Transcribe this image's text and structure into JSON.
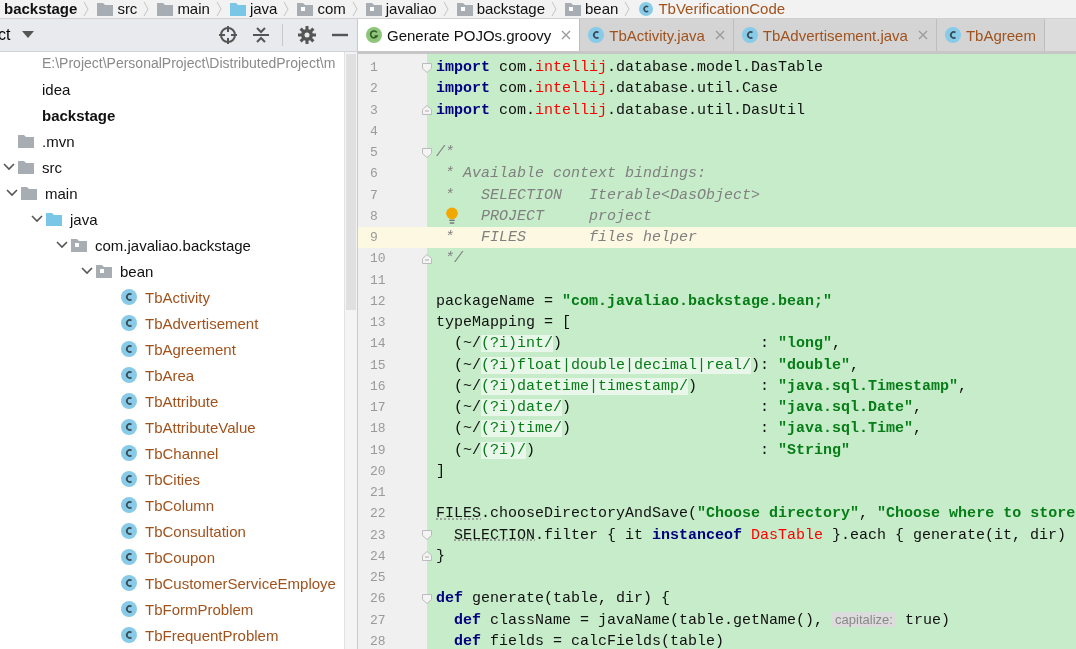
{
  "breadcrumbs": [
    {
      "label": "backstage",
      "kind": "module"
    },
    {
      "label": "src",
      "kind": "folder"
    },
    {
      "label": "main",
      "kind": "folder"
    },
    {
      "label": "java",
      "kind": "source-folder"
    },
    {
      "label": "com",
      "kind": "package"
    },
    {
      "label": "javaliao",
      "kind": "package"
    },
    {
      "label": "backstage",
      "kind": "package"
    },
    {
      "label": "bean",
      "kind": "package"
    },
    {
      "label": "TbVerificationCode",
      "kind": "class"
    }
  ],
  "project_panel": {
    "title": "ct",
    "tree": [
      {
        "label": "E:\\Project\\PersonalProject\\DistributedProject\\m",
        "kind": "path"
      },
      {
        "label": "idea",
        "kind": "item"
      },
      {
        "label": "backstage",
        "kind": "module"
      },
      {
        "label": ".mvn",
        "kind": "folder"
      },
      {
        "label": "src",
        "kind": "folder",
        "expanded": true,
        "children": [
          {
            "label": "main",
            "kind": "folder",
            "expanded": true,
            "children": [
              {
                "label": "java",
                "kind": "source-folder",
                "expanded": true,
                "children": [
                  {
                    "label": "com.javaliao.backstage",
                    "kind": "package",
                    "expanded": true,
                    "children": [
                      {
                        "label": "bean",
                        "kind": "package",
                        "expanded": true,
                        "children": [
                          {
                            "label": "TbActivity",
                            "kind": "class"
                          },
                          {
                            "label": "TbAdvertisement",
                            "kind": "class"
                          },
                          {
                            "label": "TbAgreement",
                            "kind": "class"
                          },
                          {
                            "label": "TbArea",
                            "kind": "class"
                          },
                          {
                            "label": "TbAttribute",
                            "kind": "class"
                          },
                          {
                            "label": "TbAttributeValue",
                            "kind": "class"
                          },
                          {
                            "label": "TbChannel",
                            "kind": "class"
                          },
                          {
                            "label": "TbCities",
                            "kind": "class"
                          },
                          {
                            "label": "TbColumn",
                            "kind": "class"
                          },
                          {
                            "label": "TbConsultation",
                            "kind": "class"
                          },
                          {
                            "label": "TbCoupon",
                            "kind": "class"
                          },
                          {
                            "label": "TbCustomerServiceEmploye",
                            "kind": "class"
                          },
                          {
                            "label": "TbFormProblem",
                            "kind": "class"
                          },
                          {
                            "label": "TbFrequentProblem",
                            "kind": "class"
                          }
                        ]
                      }
                    ]
                  }
                ]
              }
            ]
          }
        ]
      }
    ]
  },
  "tabs": [
    {
      "label": "Generate POJOs.groovy",
      "kind": "groovy",
      "selected": true,
      "closable": true
    },
    {
      "label": "TbActivity.java",
      "kind": "class",
      "selected": false,
      "closable": true
    },
    {
      "label": "TbAdvertisement.java",
      "kind": "class",
      "selected": false,
      "closable": true
    },
    {
      "label": "TbAgreem",
      "kind": "class",
      "selected": false,
      "closable": false
    }
  ],
  "editor": {
    "lines": [
      {
        "number": "1",
        "current": false,
        "fold_start": true,
        "segments": [
          {
            "kind": "kw",
            "text": "import"
          },
          {
            "kind": "plain",
            "text": " com."
          },
          {
            "kind": "red",
            "text": "intellij"
          },
          {
            "kind": "plain",
            "text": ".database.model.DasTable"
          }
        ]
      },
      {
        "number": "2",
        "current": false,
        "segments": [
          {
            "kind": "kw",
            "text": "import"
          },
          {
            "kind": "plain",
            "text": " com."
          },
          {
            "kind": "red",
            "text": "intellij"
          },
          {
            "kind": "plain",
            "text": ".database.util.Case"
          }
        ]
      },
      {
        "number": "3",
        "current": false,
        "fold_end": true,
        "segments": [
          {
            "kind": "kw",
            "text": "import"
          },
          {
            "kind": "plain",
            "text": " com."
          },
          {
            "kind": "red",
            "text": "intellij"
          },
          {
            "kind": "plain",
            "text": ".database.util.DasUtil"
          }
        ]
      },
      {
        "number": "4",
        "current": false
      },
      {
        "number": "5",
        "current": false,
        "fold_start": true,
        "segments": [
          {
            "kind": "comment",
            "text": "/*"
          }
        ]
      },
      {
        "number": "6",
        "current": false,
        "segments": [
          {
            "kind": "comment",
            "text": " * Available context bindings:"
          }
        ]
      },
      {
        "number": "7",
        "current": false,
        "segments": [
          {
            "kind": "comment",
            "text": " *   SELECTION   Iterable<DasObject>"
          }
        ]
      },
      {
        "number": "8",
        "current": false,
        "bulb": true,
        "segments": [
          {
            "kind": "comment",
            "text": "PROJECT     project"
          }
        ]
      },
      {
        "number": "9",
        "current": true,
        "segments": [
          {
            "kind": "comment",
            "text": " *   FILES       files helper"
          }
        ]
      },
      {
        "number": "10",
        "current": false,
        "fold_end": true,
        "segments": [
          {
            "kind": "comment",
            "text": " */"
          }
        ]
      },
      {
        "number": "11",
        "current": false
      },
      {
        "number": "12",
        "current": false,
        "segments": [
          {
            "kind": "plain",
            "text": "packageName = "
          },
          {
            "kind": "str",
            "text": "\"com.javaliao.backstage.bean;\""
          }
        ]
      },
      {
        "number": "13",
        "current": false,
        "segments": [
          {
            "kind": "plain",
            "text": "typeMapping = ["
          }
        ]
      },
      {
        "number": "14",
        "current": false,
        "segments": [
          {
            "kind": "plain",
            "text": "  (~/"
          },
          {
            "kind": "regex",
            "text": "(?i)int/"
          },
          {
            "kind": "plain",
            "text": ")                      : "
          },
          {
            "kind": "str",
            "text": "\"long\""
          },
          {
            "kind": "plain",
            "text": ","
          }
        ]
      },
      {
        "number": "15",
        "current": false,
        "segments": [
          {
            "kind": "plain",
            "text": "  (~/"
          },
          {
            "kind": "regex",
            "text": "(?i)float|double|decimal|real/"
          },
          {
            "kind": "plain",
            "text": "): "
          },
          {
            "kind": "str",
            "text": "\"double\""
          },
          {
            "kind": "plain",
            "text": ","
          }
        ]
      },
      {
        "number": "16",
        "current": false,
        "segments": [
          {
            "kind": "plain",
            "text": "  (~/"
          },
          {
            "kind": "regex",
            "text": "(?i)datetime|timestamp/"
          },
          {
            "kind": "plain",
            "text": ")       : "
          },
          {
            "kind": "str",
            "text": "\"java.sql.Timestamp\""
          },
          {
            "kind": "plain",
            "text": ","
          }
        ]
      },
      {
        "number": "17",
        "current": false,
        "segments": [
          {
            "kind": "plain",
            "text": "  (~/"
          },
          {
            "kind": "regex",
            "text": "(?i)date/"
          },
          {
            "kind": "plain",
            "text": ")                     : "
          },
          {
            "kind": "str",
            "text": "\"java.sql.Date\""
          },
          {
            "kind": "plain",
            "text": ","
          }
        ]
      },
      {
        "number": "18",
        "current": false,
        "segments": [
          {
            "kind": "plain",
            "text": "  (~/"
          },
          {
            "kind": "regex",
            "text": "(?i)time/"
          },
          {
            "kind": "plain",
            "text": ")                     : "
          },
          {
            "kind": "str",
            "text": "\"java.sql.Time\""
          },
          {
            "kind": "plain",
            "text": ","
          }
        ]
      },
      {
        "number": "19",
        "current": false,
        "segments": [
          {
            "kind": "plain",
            "text": "  (~/"
          },
          {
            "kind": "regex",
            "text": "(?i)/"
          },
          {
            "kind": "plain",
            "text": ")                         : "
          },
          {
            "kind": "str",
            "text": "\"String\""
          }
        ]
      },
      {
        "number": "20",
        "current": false,
        "segments": [
          {
            "kind": "plain",
            "text": "]"
          }
        ]
      },
      {
        "number": "21",
        "current": false
      },
      {
        "number": "22",
        "current": false,
        "segments": [
          {
            "kind": "dotted",
            "text": "FILES"
          },
          {
            "kind": "plain",
            "text": ".chooseDirectoryAndSave("
          },
          {
            "kind": "str",
            "text": "\"Choose directory\""
          },
          {
            "kind": "plain",
            "text": ", "
          },
          {
            "kind": "str",
            "text": "\"Choose where to store"
          }
        ]
      },
      {
        "number": "23",
        "current": false,
        "fold_start": true,
        "indented": true,
        "segments": [
          {
            "kind": "dotted",
            "text": "SELECTION"
          },
          {
            "kind": "plain",
            "text": ".filter { it "
          },
          {
            "kind": "kw",
            "text": "instanceof"
          },
          {
            "kind": "red",
            "text": " DasTable"
          },
          {
            "kind": "plain",
            "text": " }.each { generate(it, dir)"
          }
        ]
      },
      {
        "number": "24",
        "current": false,
        "fold_end": true,
        "segments": [
          {
            "kind": "plain",
            "text": "}"
          }
        ]
      },
      {
        "number": "25",
        "current": false
      },
      {
        "number": "26",
        "current": false,
        "fold_start": true,
        "segments": [
          {
            "kind": "kw",
            "text": "def"
          },
          {
            "kind": "plain",
            "text": " generate(table, dir) {"
          }
        ]
      },
      {
        "number": "27",
        "current": false,
        "indented": true,
        "segments": [
          {
            "kind": "kw",
            "text": "def"
          },
          {
            "kind": "plain",
            "text": " className = javaName(table.getName(), "
          },
          {
            "kind": "hint",
            "text": "capitalize:"
          },
          {
            "kind": "plain",
            "text": " true)"
          }
        ]
      },
      {
        "number": "28",
        "current": false,
        "indented": true,
        "segments": [
          {
            "kind": "kw",
            "text": "def"
          },
          {
            "kind": "plain",
            "text": " fields = calcFields(table)"
          }
        ]
      }
    ]
  }
}
